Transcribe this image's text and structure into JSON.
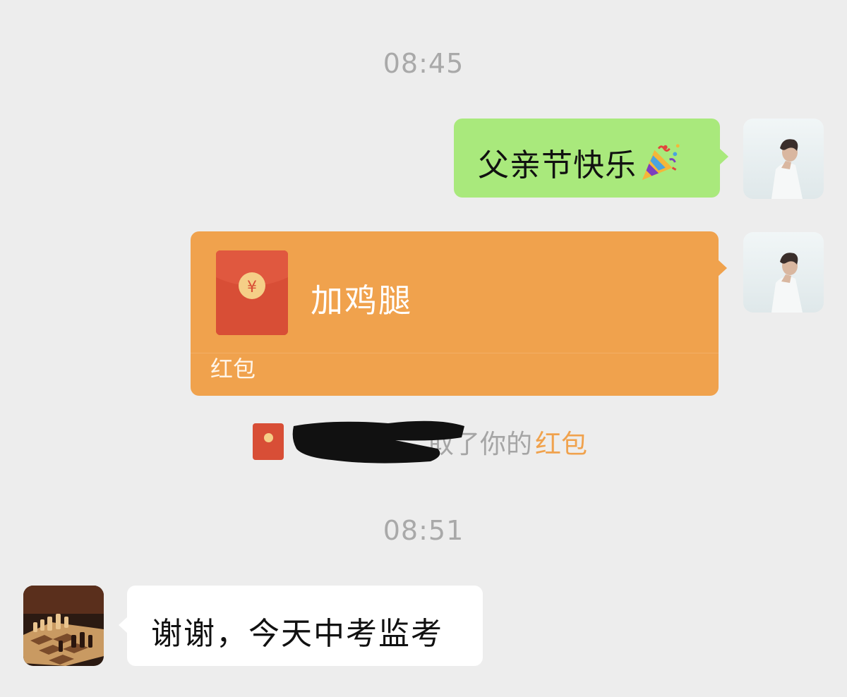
{
  "chat": {
    "timestamps": [
      "08:45",
      "08:51"
    ],
    "messages": {
      "outgoing_text": "父亲节快乐",
      "outgoing_emoji_icon": "party-popper-icon",
      "red_packet": {
        "title": "加鸡腿",
        "footer_label": "红包",
        "currency_symbol": "¥"
      },
      "system_notice": {
        "text_visible": "取了你的",
        "link_text": "红包"
      },
      "incoming_text": "谢谢，今天中考监考"
    }
  },
  "colors": {
    "background": "#ededed",
    "outgoing_bubble": "#a9e97c",
    "red_packet_bubble": "#f0a24d",
    "red_packet_icon": "#d84e36",
    "incoming_bubble": "#ffffff",
    "timestamp_text": "#a9a9a9"
  }
}
